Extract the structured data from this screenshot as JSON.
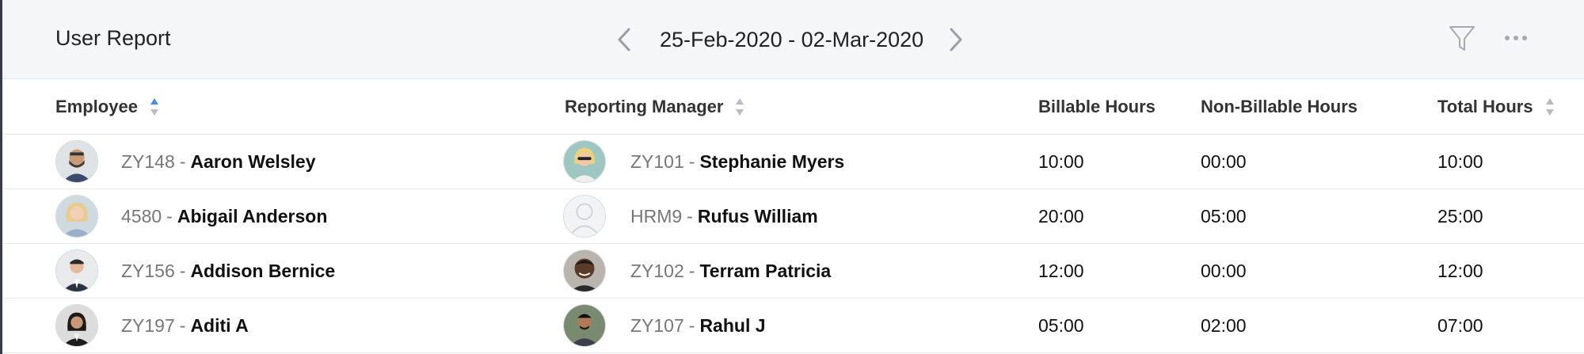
{
  "header": {
    "title": "User Report",
    "date_range": "25-Feb-2020 - 02-Mar-2020",
    "prev_icon": "chevron-left-icon",
    "next_icon": "chevron-right-icon",
    "filter_icon": "filter-icon",
    "more_icon": "more-options-icon"
  },
  "columns": {
    "employee": "Employee",
    "manager": "Reporting Manager",
    "billable": "Billable Hours",
    "non_billable": "Non-Billable Hours",
    "total": "Total Hours"
  },
  "rows": [
    {
      "employee": {
        "id": "ZY148",
        "sep": "-",
        "name": "Aaron Welsley"
      },
      "manager": {
        "id": "ZY101",
        "sep": "-",
        "name": "Stephanie Myers"
      },
      "billable": "10:00",
      "non_billable": "00:00",
      "total": "10:00"
    },
    {
      "employee": {
        "id": "4580",
        "sep": "-",
        "name": "Abigail Anderson"
      },
      "manager": {
        "id": "HRM9",
        "sep": "-",
        "name": "Rufus William"
      },
      "billable": "20:00",
      "non_billable": "05:00",
      "total": "25:00"
    },
    {
      "employee": {
        "id": "ZY156",
        "sep": "-",
        "name": "Addison Bernice"
      },
      "manager": {
        "id": "ZY102",
        "sep": "-",
        "name": "Terram Patricia"
      },
      "billable": "12:00",
      "non_billable": "00:00",
      "total": "12:00"
    },
    {
      "employee": {
        "id": "ZY197",
        "sep": "-",
        "name": "Aditi A"
      },
      "manager": {
        "id": "ZY107",
        "sep": "-",
        "name": "Rahul J"
      },
      "billable": "05:00",
      "non_billable": "02:00",
      "total": "07:00"
    }
  ],
  "colors": {
    "header_bg": "#f5f6f8",
    "sort_active": "#4a90d9",
    "sort_inactive": "#b8bcc2"
  }
}
